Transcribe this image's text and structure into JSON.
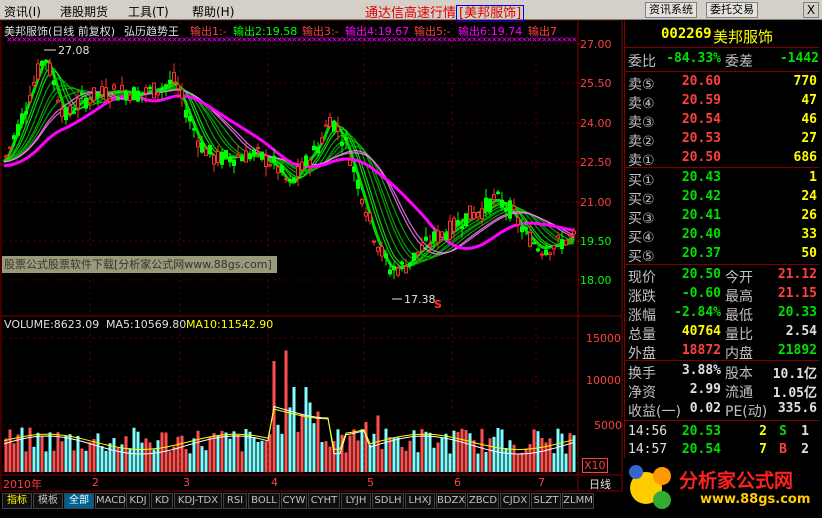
{
  "menu": {
    "items": [
      "资讯(I)",
      "港股期货",
      "工具(T)",
      "帮助(H)"
    ]
  },
  "app_title": {
    "prefix": "通达信高速行情",
    "stock": "[美邦服饰]"
  },
  "window_buttons": {
    "news": "资讯系统",
    "trade": "委托交易",
    "close": "X"
  },
  "chart_header": {
    "name": "美邦服饰(日线 前复权)",
    "indicator": "弘历趋势王",
    "outputs": [
      "输出1:-",
      "输出2:19.58",
      "输出3:-",
      "输出4:19.67",
      "输出5:-",
      "输出6:19.74",
      "输出7"
    ]
  },
  "price_axis": {
    "ticks": [
      "27.00",
      "25.50",
      "24.00",
      "22.50",
      "21.00",
      "19.50",
      "18.00"
    ]
  },
  "annotations": {
    "high": "27.08",
    "low": "17.38",
    "s_marker": "S"
  },
  "watermark": "股票公式股票软件下载[分析家公式网www.88gs.com]",
  "volume_header": {
    "volume": "VOLUME:8623.09",
    "ma5": "MA5:10569.80",
    "ma10": "MA10:11542.90"
  },
  "volume_axis": {
    "ticks": [
      "15000",
      "10000",
      "5000"
    ],
    "unit": "X10"
  },
  "time_axis": {
    "labels": [
      "2010年",
      "2",
      "3",
      "4",
      "5",
      "6",
      "7"
    ],
    "period": "日线"
  },
  "indicator_tabs": [
    "指标",
    "模板",
    "全部",
    "MACD",
    "KDJ",
    "KD",
    "KDJ-TDX",
    "RSI",
    "BOLL",
    "CYW",
    "CYHT",
    "LYJH",
    "SDLH",
    "LHXJ",
    "BDZX",
    "ZBCD",
    "CJDX",
    "SLZT",
    "ZLMM"
  ],
  "quote": {
    "code": "002269",
    "name": "美邦服饰",
    "weibi_label": "委比",
    "weibi": "-84.33%",
    "weicha_label": "委差",
    "weicha": "-1442",
    "sells": [
      {
        "label": "卖⑤",
        "price": "20.60",
        "vol": "770"
      },
      {
        "label": "卖④",
        "price": "20.59",
        "vol": "47"
      },
      {
        "label": "卖③",
        "price": "20.54",
        "vol": "46"
      },
      {
        "label": "卖②",
        "price": "20.53",
        "vol": "27"
      },
      {
        "label": "卖①",
        "price": "20.50",
        "vol": "686"
      }
    ],
    "buys": [
      {
        "label": "买①",
        "price": "20.43",
        "vol": "1"
      },
      {
        "label": "买②",
        "price": "20.42",
        "vol": "24"
      },
      {
        "label": "买③",
        "price": "20.41",
        "vol": "26"
      },
      {
        "label": "买④",
        "price": "20.40",
        "vol": "33"
      },
      {
        "label": "买⑤",
        "price": "20.37",
        "vol": "50"
      }
    ],
    "stats": [
      {
        "l1": "现价",
        "v1": "20.50",
        "c1": "green",
        "l2": "今开",
        "v2": "21.12",
        "c2": "red"
      },
      {
        "l1": "涨跌",
        "v1": "-0.60",
        "c1": "green",
        "l2": "最高",
        "v2": "21.15",
        "c2": "red"
      },
      {
        "l1": "涨幅",
        "v1": "-2.84%",
        "c1": "green",
        "l2": "最低",
        "v2": "20.33",
        "c2": "green"
      },
      {
        "l1": "总量",
        "v1": "40764",
        "c1": "yellow",
        "l2": "量比",
        "v2": "2.54",
        "c2": "white"
      },
      {
        "l1": "外盘",
        "v1": "18872",
        "c1": "red",
        "l2": "内盘",
        "v2": "21892",
        "c2": "green"
      }
    ],
    "fund": [
      {
        "l1": "换手",
        "v1": "3.88%",
        "l2": "股本",
        "v2": "10.1亿"
      },
      {
        "l1": "净资",
        "v1": "2.99",
        "l2": "流通",
        "v2": "1.05亿"
      },
      {
        "l1": "收益(一)",
        "v1": "0.02",
        "l2": "PE(动)",
        "v2": "335.6"
      }
    ],
    "ticks": [
      {
        "time": "14:56",
        "price": "20.53",
        "vol": "2",
        "side": "S",
        "flag": "1"
      },
      {
        "time": "14:57",
        "price": "20.54",
        "vol": "7",
        "side": "B",
        "flag": "2"
      }
    ]
  },
  "logo": {
    "text": "分析家公式网",
    "url": "www.88gs.com"
  },
  "colors": {
    "up": "#ff3030",
    "down": "#00ff00",
    "vol_up": "#ff5050",
    "vol_down": "#80ffff",
    "ribbon_up": "#00ff00",
    "ribbon_low": "#ff00ff",
    "grid": "#800000"
  }
}
